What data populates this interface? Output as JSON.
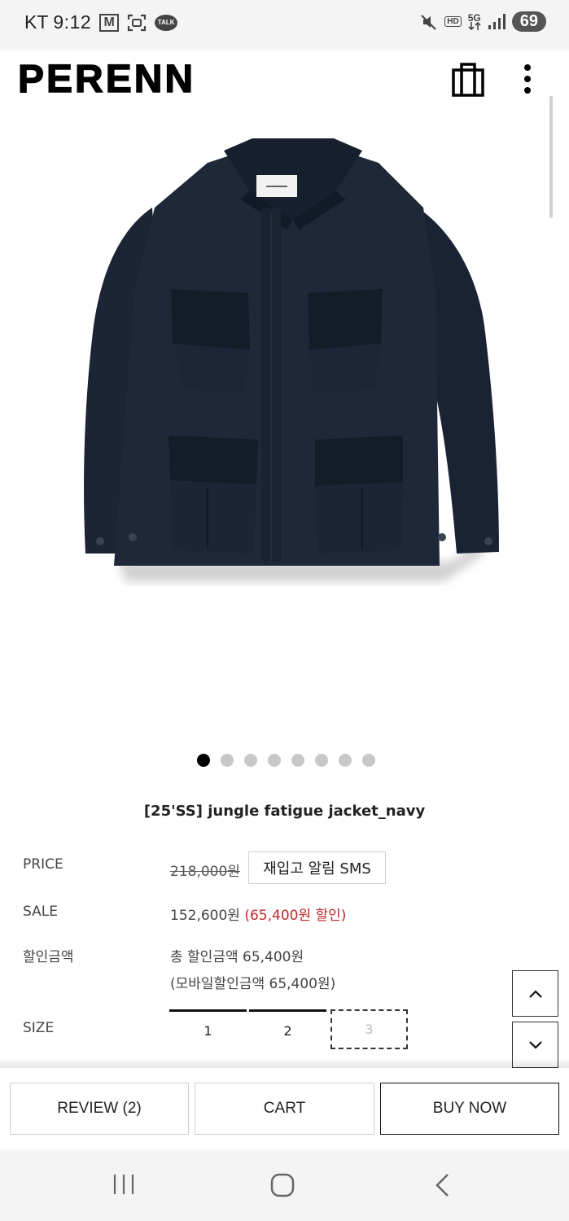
{
  "status_bar": {
    "carrier": "KT",
    "time": "9:12",
    "gmail_letter": "M",
    "talk_label": "TALK",
    "hd_label": "HD",
    "network_label": "5G",
    "battery": "69"
  },
  "header": {
    "logo": "PERENN"
  },
  "gallery": {
    "total_images": 8,
    "active_index": 0
  },
  "product": {
    "name": "[25'SS] jungle fatigue jacket_navy",
    "price_label": "PRICE",
    "price_original": "218,000원",
    "restock_button": "재입고 알림 SMS",
    "sale_label": "SALE",
    "sale_price": "152,600원",
    "sale_discount": "(65,400원 할인)",
    "discount_label": "할인금액",
    "total_discount": "총 할인금액 65,400원",
    "mobile_discount": "(모바일할인금액 65,400원)",
    "size_label": "SIZE",
    "sizes": [
      {
        "label": "1",
        "available": true
      },
      {
        "label": "2",
        "available": true
      },
      {
        "label": "3",
        "available": false
      }
    ]
  },
  "bottom_bar": {
    "review": "REVIEW (2)",
    "cart": "CART",
    "buy_now": "BUY NOW"
  },
  "colors": {
    "sale_red": "#c0292b",
    "jacket_navy": "#1c2535"
  }
}
